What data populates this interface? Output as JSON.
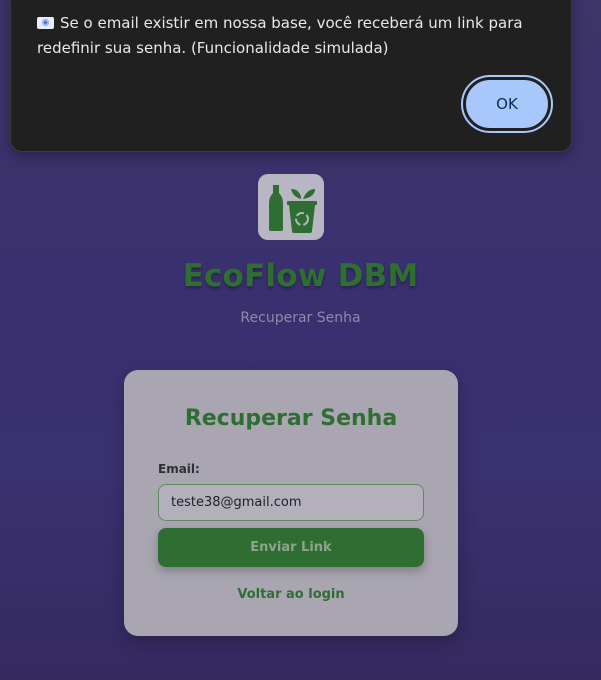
{
  "brand": {
    "title": "EcoFlow DBM",
    "subtitle": "Recuperar Senha",
    "logo_icon": "bottle-and-recycling-bin-icon"
  },
  "card": {
    "title": "Recuperar Senha",
    "email_label": "Email:",
    "email_value": "teste38@gmail.com",
    "submit_label": "Enviar Link",
    "back_link_label": "Voltar ao login"
  },
  "dialog": {
    "message": "Se o email existir em nossa base, você receberá um link para redefinir sua senha. (Funcionalidade simulada)",
    "ok_label": "OK"
  },
  "colors": {
    "background": "#3a3170",
    "brand_green": "#2f6e33",
    "dialog_bg": "#202020",
    "ok_button": "#a8c7fa"
  }
}
